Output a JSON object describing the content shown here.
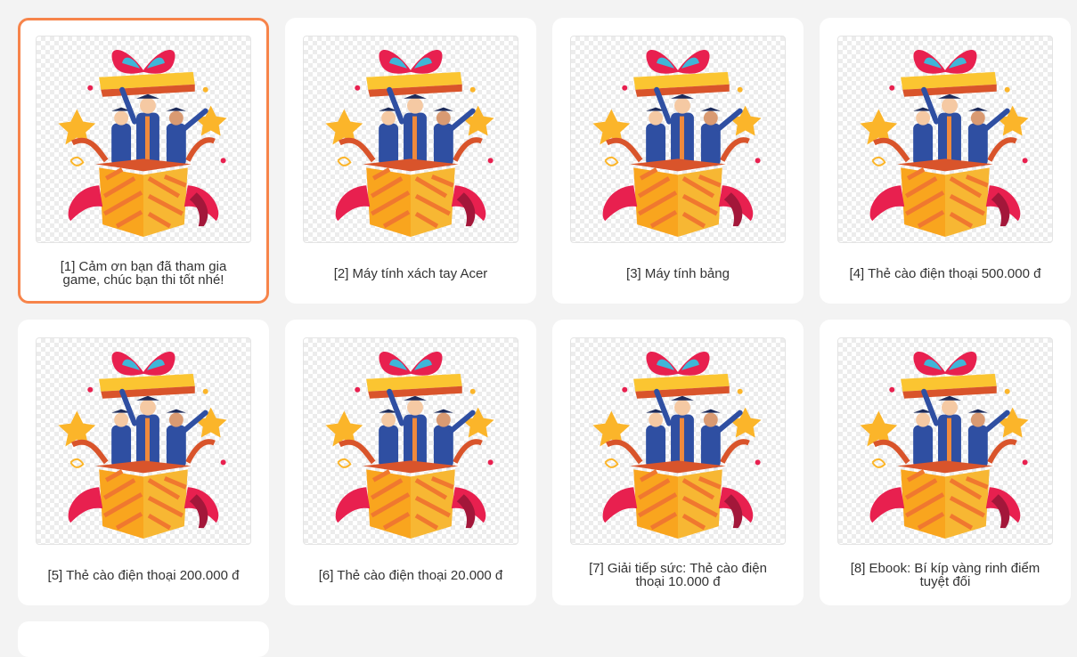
{
  "prizes": [
    {
      "label": "[1] Cảm ơn bạn đã tham gia game, chúc bạn thi tốt nhé!",
      "selected": true
    },
    {
      "label": "[2] Máy tính xách tay Acer",
      "selected": false
    },
    {
      "label": "[3] Máy tính bảng",
      "selected": false
    },
    {
      "label": "[4] Thẻ cào điện thoại 500.000 đ",
      "selected": false
    },
    {
      "label": "[5] Thẻ cào điện thoại 200.000 đ",
      "selected": false
    },
    {
      "label": "[6] Thẻ cào điện thoại 20.000 đ",
      "selected": false
    },
    {
      "label": "[7] Giải tiếp sức: Thẻ cào điện thoại 10.000 đ",
      "selected": false
    },
    {
      "label": "[8] Ebook: Bí kíp vàng rinh điểm tuyệt đối",
      "selected": false
    }
  ],
  "colors": {
    "selected_border": "#f7844a",
    "ribbon": "#e8204f",
    "box": "#f9a51e",
    "gown": "#2f4fa2"
  },
  "image_icon": "gift-box-graduates-illustration"
}
